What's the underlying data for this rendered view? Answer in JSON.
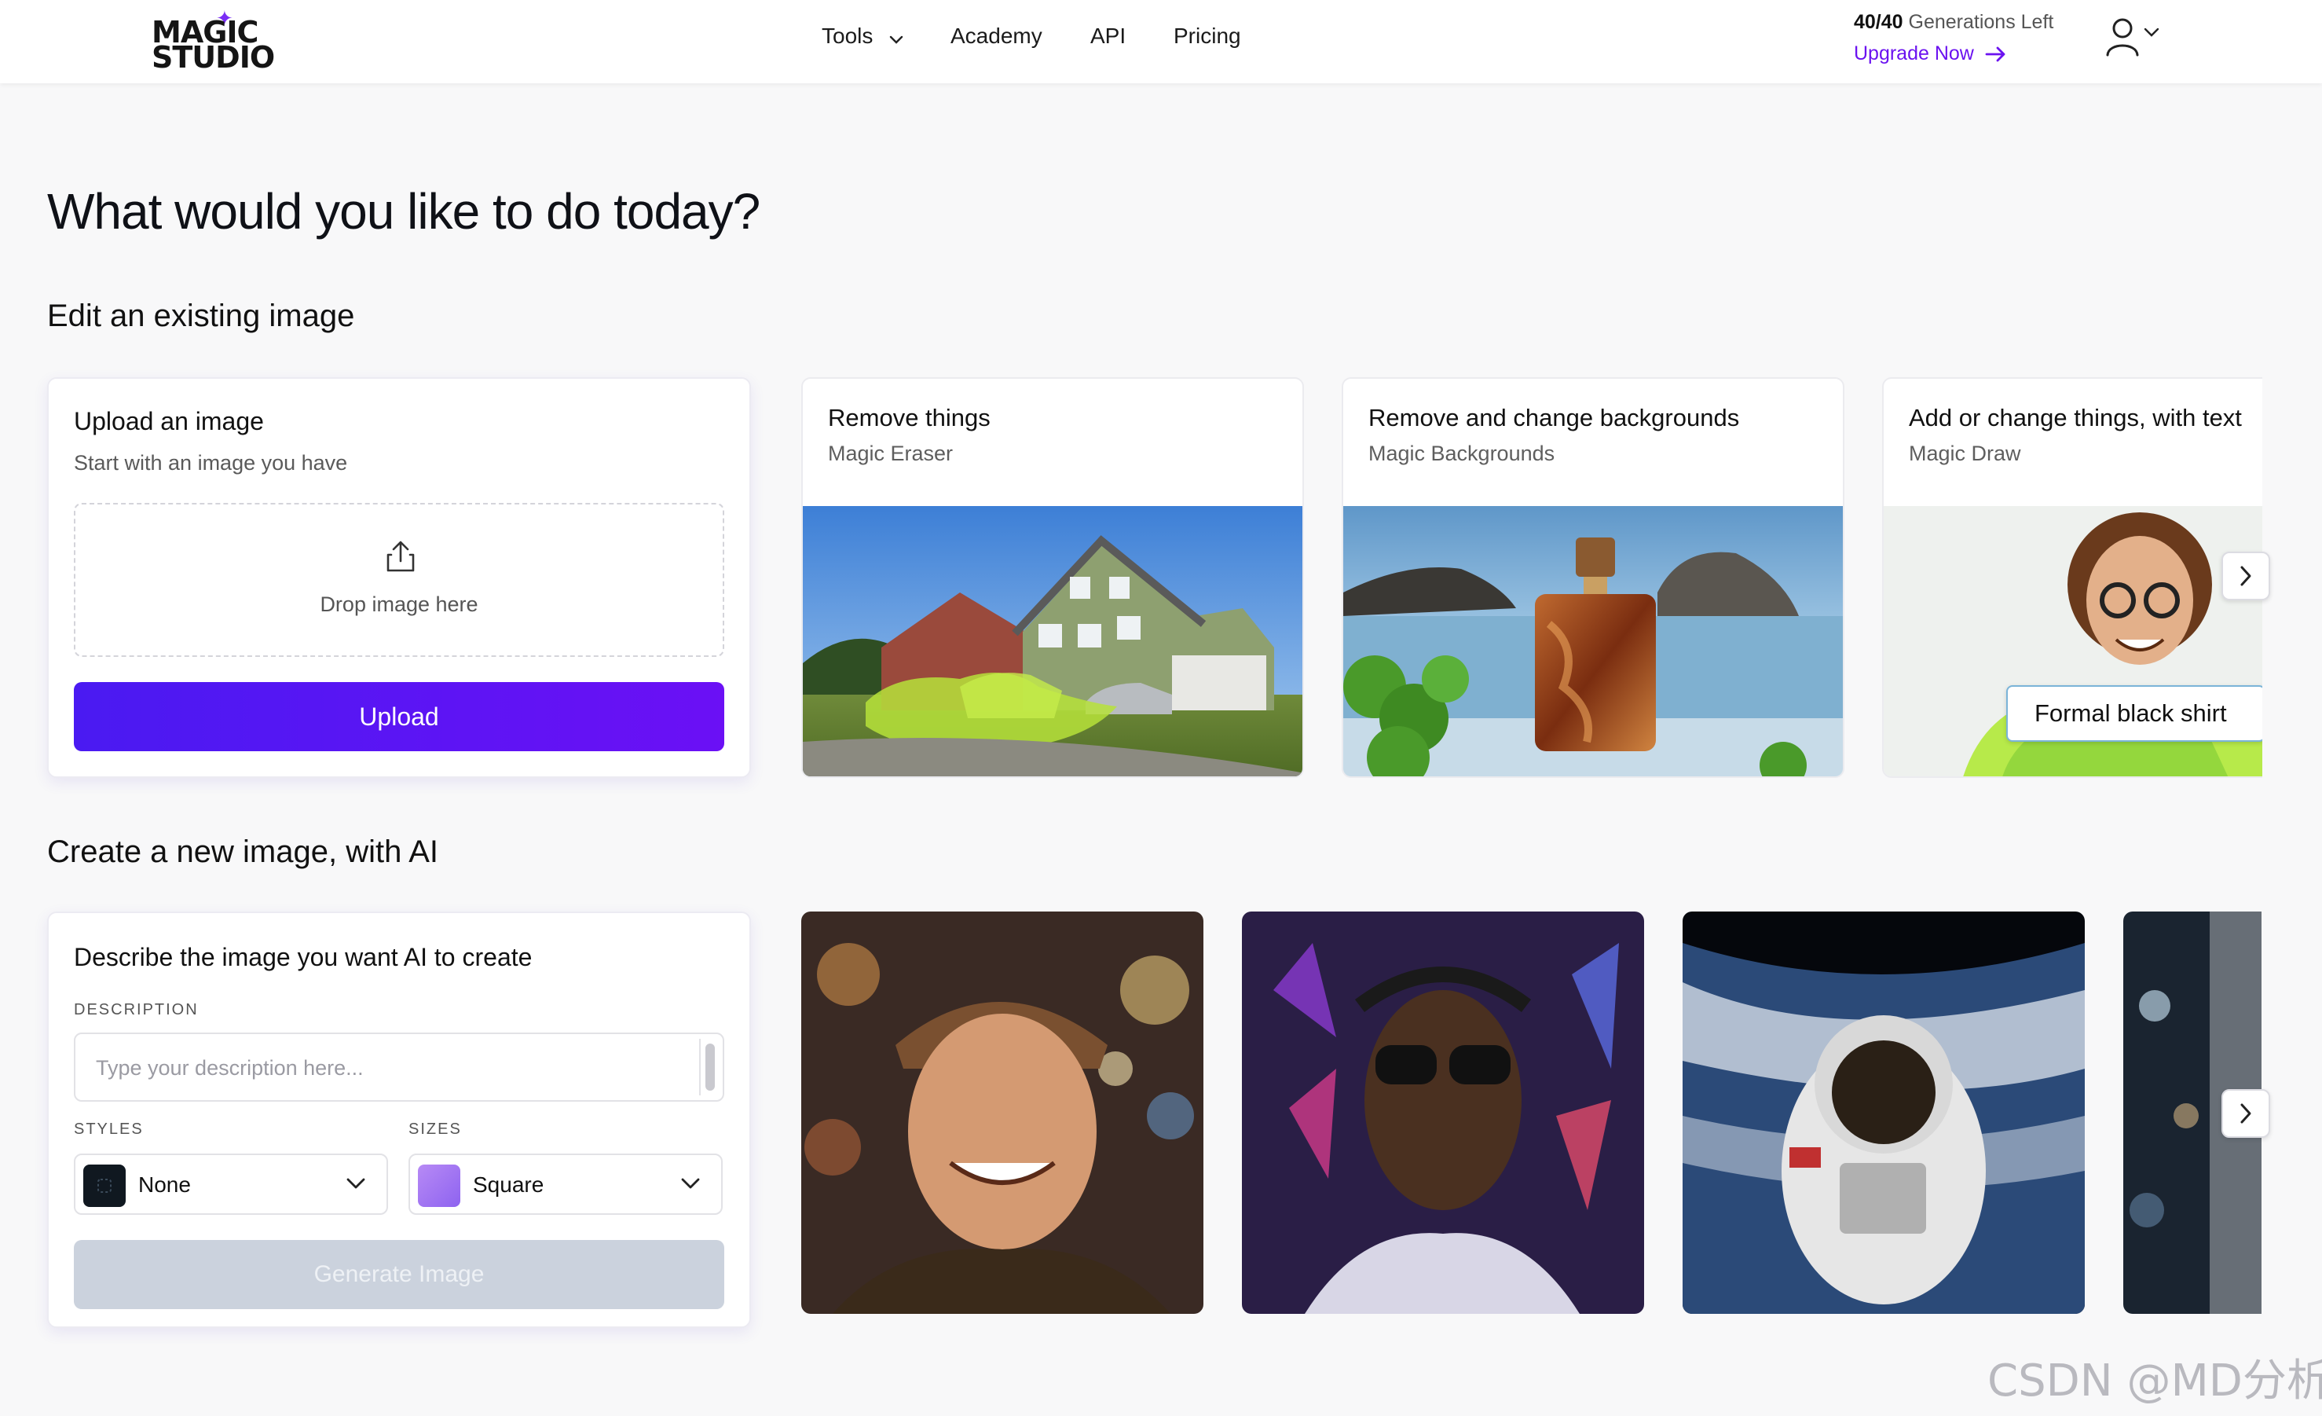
{
  "header": {
    "logo_line1": "MAGIC",
    "logo_line2": "STUDIO",
    "nav": [
      {
        "label": "Tools"
      },
      {
        "label": "Academy"
      },
      {
        "label": "API"
      },
      {
        "label": "Pricing"
      }
    ],
    "generations_count": "40/40",
    "generations_label": "Generations Left",
    "upgrade_label": "Upgrade Now"
  },
  "page_title": "What would you like to do today?",
  "edit_section": {
    "heading": "Edit an existing image",
    "upload_card": {
      "title": "Upload an image",
      "subtitle": "Start with an image you have",
      "drop_text": "Drop image here",
      "button": "Upload"
    },
    "tools": [
      {
        "title": "Remove things",
        "subtitle": "Magic Eraser"
      },
      {
        "title": "Remove and change backgrounds",
        "subtitle": "Magic Backgrounds"
      },
      {
        "title": "Add or change things, with text",
        "subtitle": "Magic Draw",
        "prompt_chip": "Formal black shirt"
      }
    ]
  },
  "create_section": {
    "heading": "Create a new image, with AI",
    "card": {
      "title": "Describe the image you want AI to create",
      "description_label": "DESCRIPTION",
      "description_placeholder": "Type your description here...",
      "styles_label": "STYLES",
      "style_value": "None",
      "sizes_label": "SIZES",
      "size_value": "Square",
      "button": "Generate Image"
    }
  },
  "watermark": "CSDN @MD分析",
  "colors": {
    "accent": "#6b12f0",
    "upload_button": "#5214f3",
    "generate_disabled": "#cbd2dd"
  }
}
